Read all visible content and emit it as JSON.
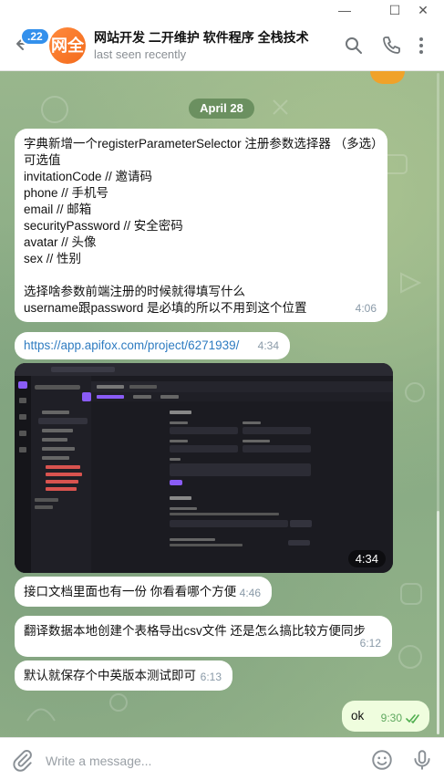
{
  "window": {
    "minimize": "—",
    "maximize": "☐",
    "close": "✕"
  },
  "header": {
    "unread_count": ".22",
    "avatar_text": "网全",
    "title": "网站开发 二开维护 软件程序 全栈技术",
    "status": "last seen recently"
  },
  "date_chip": "April 28",
  "messages": [
    {
      "lines": [
        "字典新增一个registerParameterSelector 注册参数选择器 （多选）",
        "可选值",
        "invitationCode // 邀请码",
        "phone // 手机号",
        "email // 邮箱",
        "securityPassword // 安全密码",
        "avatar // 头像",
        "sex // 性别",
        "",
        "选择啥参数前端注册的时候就得填写什么",
        "username跟password 是必填的所以不用到这个位置"
      ],
      "time": "4:06"
    },
    {
      "text": "https://app.apifox.com/project/6271939/",
      "time": "4:34"
    },
    {
      "media_time": "4:34"
    },
    {
      "text": "接口文档里面也有一份 你看看哪个方便",
      "time": "4:46"
    },
    {
      "text": "翻译数据本地创建个表格导出csv文件 还是怎么搞比较方便同步",
      "time": "6:12"
    },
    {
      "text": "默认就保存个中英版本测试即可",
      "time": "6:13"
    },
    {
      "text": "ok",
      "time": "9:30",
      "outgoing": true
    }
  ],
  "composer": {
    "placeholder": "Write a message..."
  },
  "colors": {
    "accent": "#3390ec",
    "link": "#2f7cc1",
    "outgoing_bg": "#effdde",
    "avatar": "#f36b1c"
  },
  "icons": [
    "back-arrow-icon",
    "search-icon",
    "phone-icon",
    "more-vertical-icon",
    "attach-icon",
    "emoji-icon",
    "microphone-icon",
    "double-check-icon"
  ]
}
